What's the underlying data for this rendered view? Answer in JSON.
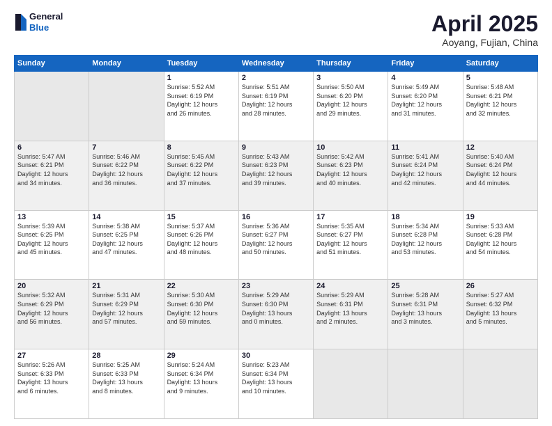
{
  "header": {
    "logo_general": "General",
    "logo_blue": "Blue",
    "month_title": "April 2025",
    "subtitle": "Aoyang, Fujian, China"
  },
  "weekdays": [
    "Sunday",
    "Monday",
    "Tuesday",
    "Wednesday",
    "Thursday",
    "Friday",
    "Saturday"
  ],
  "weeks": [
    [
      {
        "day": "",
        "info": ""
      },
      {
        "day": "",
        "info": ""
      },
      {
        "day": "1",
        "info": "Sunrise: 5:52 AM\nSunset: 6:19 PM\nDaylight: 12 hours\nand 26 minutes."
      },
      {
        "day": "2",
        "info": "Sunrise: 5:51 AM\nSunset: 6:19 PM\nDaylight: 12 hours\nand 28 minutes."
      },
      {
        "day": "3",
        "info": "Sunrise: 5:50 AM\nSunset: 6:20 PM\nDaylight: 12 hours\nand 29 minutes."
      },
      {
        "day": "4",
        "info": "Sunrise: 5:49 AM\nSunset: 6:20 PM\nDaylight: 12 hours\nand 31 minutes."
      },
      {
        "day": "5",
        "info": "Sunrise: 5:48 AM\nSunset: 6:21 PM\nDaylight: 12 hours\nand 32 minutes."
      }
    ],
    [
      {
        "day": "6",
        "info": "Sunrise: 5:47 AM\nSunset: 6:21 PM\nDaylight: 12 hours\nand 34 minutes."
      },
      {
        "day": "7",
        "info": "Sunrise: 5:46 AM\nSunset: 6:22 PM\nDaylight: 12 hours\nand 36 minutes."
      },
      {
        "day": "8",
        "info": "Sunrise: 5:45 AM\nSunset: 6:22 PM\nDaylight: 12 hours\nand 37 minutes."
      },
      {
        "day": "9",
        "info": "Sunrise: 5:43 AM\nSunset: 6:23 PM\nDaylight: 12 hours\nand 39 minutes."
      },
      {
        "day": "10",
        "info": "Sunrise: 5:42 AM\nSunset: 6:23 PM\nDaylight: 12 hours\nand 40 minutes."
      },
      {
        "day": "11",
        "info": "Sunrise: 5:41 AM\nSunset: 6:24 PM\nDaylight: 12 hours\nand 42 minutes."
      },
      {
        "day": "12",
        "info": "Sunrise: 5:40 AM\nSunset: 6:24 PM\nDaylight: 12 hours\nand 44 minutes."
      }
    ],
    [
      {
        "day": "13",
        "info": "Sunrise: 5:39 AM\nSunset: 6:25 PM\nDaylight: 12 hours\nand 45 minutes."
      },
      {
        "day": "14",
        "info": "Sunrise: 5:38 AM\nSunset: 6:25 PM\nDaylight: 12 hours\nand 47 minutes."
      },
      {
        "day": "15",
        "info": "Sunrise: 5:37 AM\nSunset: 6:26 PM\nDaylight: 12 hours\nand 48 minutes."
      },
      {
        "day": "16",
        "info": "Sunrise: 5:36 AM\nSunset: 6:27 PM\nDaylight: 12 hours\nand 50 minutes."
      },
      {
        "day": "17",
        "info": "Sunrise: 5:35 AM\nSunset: 6:27 PM\nDaylight: 12 hours\nand 51 minutes."
      },
      {
        "day": "18",
        "info": "Sunrise: 5:34 AM\nSunset: 6:28 PM\nDaylight: 12 hours\nand 53 minutes."
      },
      {
        "day": "19",
        "info": "Sunrise: 5:33 AM\nSunset: 6:28 PM\nDaylight: 12 hours\nand 54 minutes."
      }
    ],
    [
      {
        "day": "20",
        "info": "Sunrise: 5:32 AM\nSunset: 6:29 PM\nDaylight: 12 hours\nand 56 minutes."
      },
      {
        "day": "21",
        "info": "Sunrise: 5:31 AM\nSunset: 6:29 PM\nDaylight: 12 hours\nand 57 minutes."
      },
      {
        "day": "22",
        "info": "Sunrise: 5:30 AM\nSunset: 6:30 PM\nDaylight: 12 hours\nand 59 minutes."
      },
      {
        "day": "23",
        "info": "Sunrise: 5:29 AM\nSunset: 6:30 PM\nDaylight: 13 hours\nand 0 minutes."
      },
      {
        "day": "24",
        "info": "Sunrise: 5:29 AM\nSunset: 6:31 PM\nDaylight: 13 hours\nand 2 minutes."
      },
      {
        "day": "25",
        "info": "Sunrise: 5:28 AM\nSunset: 6:31 PM\nDaylight: 13 hours\nand 3 minutes."
      },
      {
        "day": "26",
        "info": "Sunrise: 5:27 AM\nSunset: 6:32 PM\nDaylight: 13 hours\nand 5 minutes."
      }
    ],
    [
      {
        "day": "27",
        "info": "Sunrise: 5:26 AM\nSunset: 6:33 PM\nDaylight: 13 hours\nand 6 minutes."
      },
      {
        "day": "28",
        "info": "Sunrise: 5:25 AM\nSunset: 6:33 PM\nDaylight: 13 hours\nand 8 minutes."
      },
      {
        "day": "29",
        "info": "Sunrise: 5:24 AM\nSunset: 6:34 PM\nDaylight: 13 hours\nand 9 minutes."
      },
      {
        "day": "30",
        "info": "Sunrise: 5:23 AM\nSunset: 6:34 PM\nDaylight: 13 hours\nand 10 minutes."
      },
      {
        "day": "",
        "info": ""
      },
      {
        "day": "",
        "info": ""
      },
      {
        "day": "",
        "info": ""
      }
    ]
  ]
}
